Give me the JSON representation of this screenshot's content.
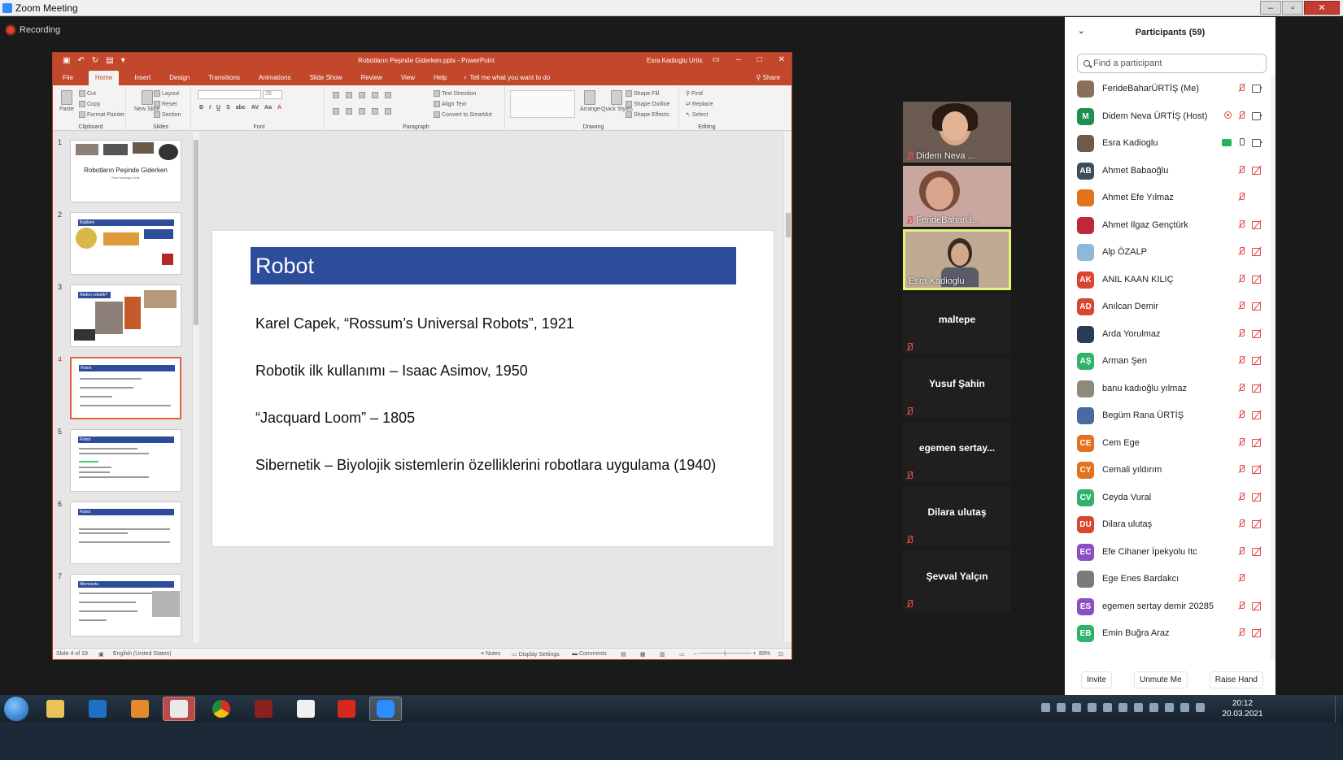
{
  "zoom": {
    "window_title": "Zoom Meeting",
    "recording_label": "Recording"
  },
  "powerpoint": {
    "doc_title": "Robotların Peşinde Giderken.pptx - PowerPoint",
    "user": "Esra Kadioglu Urtis",
    "tabs": [
      "File",
      "Home",
      "Insert",
      "Design",
      "Transitions",
      "Animations",
      "Slide Show",
      "Review",
      "View",
      "Help"
    ],
    "active_tab": "Home",
    "tell_me": "Tell me what you want to do",
    "share": "Share",
    "ribbon": {
      "paste": "Paste",
      "cut": "Cut",
      "copy": "Copy",
      "format_painter": "Format Painter",
      "clipboard": "Clipboard",
      "new_slide": "New Slide",
      "layout": "Layout",
      "reset": "Reset",
      "section": "Section",
      "slides": "Slides",
      "font": "Font",
      "font_size": "28",
      "text_direction": "Text Direction",
      "align_text": "Align Text",
      "convert_smartart": "Convert to SmartArt",
      "paragraph": "Paragraph",
      "arrange": "Arrange",
      "quick_styles": "Quick Styles",
      "shape_fill": "Shape Fill",
      "shape_outline": "Shape Outline",
      "shape_effects": "Shape Effects",
      "drawing": "Drawing",
      "find": "Find",
      "replace": "Replace",
      "select": "Select",
      "editing": "Editing"
    },
    "thumbnails": [
      {
        "num": "1",
        "title": "Robotların Peşinde Giderken",
        "subtitle": "Esra Kadioglu Urtis"
      },
      {
        "num": "2",
        "title": "Bağlantı"
      },
      {
        "num": "3",
        "title": "Neden robotik?"
      },
      {
        "num": "4",
        "title": "Robot"
      },
      {
        "num": "5",
        "title": "Robot"
      },
      {
        "num": "6",
        "title": "Robot"
      },
      {
        "num": "7",
        "title": "Minnesota"
      }
    ],
    "slide": {
      "title": "Robot",
      "lines": [
        "Karel Capek, “Rossum’s Universal Robots”, 1921",
        "Robotik ilk kullanımı – Isaac Asimov, 1950",
        "“Jacquard Loom” – 1805",
        "Sibernetik – Biyolojik sistemlerin özelliklerini robotlara uygulama (1940)"
      ]
    },
    "status": {
      "slide_info": "Slide 4 of 19",
      "language": "English (United States)",
      "notes": "Notes",
      "display_settings": "Display Settings",
      "comments": "Comments",
      "zoom": "89%"
    }
  },
  "video_tiles": [
    {
      "name": "Didem Neva ...",
      "type": "video",
      "muted": true,
      "speaking": false
    },
    {
      "name": "FerideBaharÜ...",
      "type": "video",
      "muted": true,
      "speaking": false
    },
    {
      "name": "Esra Kadioglu",
      "type": "video",
      "muted": false,
      "speaking": true
    },
    {
      "name": "maltepe",
      "type": "name",
      "muted": true
    },
    {
      "name": "Yusuf Şahin",
      "type": "name",
      "muted": true
    },
    {
      "name": "egemen sertay...",
      "type": "name",
      "muted": true
    },
    {
      "name": "Dilara ulutaş",
      "type": "name",
      "muted": true
    },
    {
      "name": "Şevval Yalçın",
      "type": "name",
      "muted": true
    }
  ],
  "participants": {
    "header": "Participants (59)",
    "search_placeholder": "Find a participant",
    "list": [
      {
        "name": "FerideBaharÜRTİŞ (Me)",
        "initials": "",
        "color": "#8a6f5c",
        "mic": "off",
        "cam": "on"
      },
      {
        "name": "Didem Neva ÜRTİŞ (Host)",
        "initials": "M",
        "color": "#1e8f4e",
        "mic": "off",
        "cam": "on",
        "rec": true
      },
      {
        "name": "Esra Kadioglu",
        "initials": "",
        "color": "#6d5a4a",
        "mic": "on",
        "cam": "on",
        "share": true
      },
      {
        "name": "Ahmet Babaoğlu",
        "initials": "AB",
        "color": "#3d4d5c",
        "mic": "off",
        "cam": "off"
      },
      {
        "name": "Ahmet Efe Yılmaz",
        "initials": "",
        "color": "#e3711d",
        "mic": "off",
        "cam": "none"
      },
      {
        "name": "Ahmet Ilgaz Gençtürk",
        "initials": "",
        "color": "#c0273b",
        "mic": "off",
        "cam": "off"
      },
      {
        "name": "Alp ÖZALP",
        "initials": "",
        "color": "#8fb8d8",
        "mic": "off",
        "cam": "off"
      },
      {
        "name": "ANIL KAAN KILIÇ",
        "initials": "AK",
        "color": "#d9452f",
        "mic": "off",
        "cam": "off"
      },
      {
        "name": "Anılcan Demir",
        "initials": "AD",
        "color": "#d9452f",
        "mic": "off",
        "cam": "off"
      },
      {
        "name": "Arda Yorulmaz",
        "initials": "",
        "color": "#2b3a55",
        "mic": "off",
        "cam": "off"
      },
      {
        "name": "Arman Şen",
        "initials": "AŞ",
        "color": "#2fb36b",
        "mic": "off",
        "cam": "off"
      },
      {
        "name": "banu kadıoğlu yılmaz",
        "initials": "",
        "color": "#8e8a7a",
        "mic": "off",
        "cam": "off"
      },
      {
        "name": "Begüm Rana ÜRTİŞ",
        "initials": "",
        "color": "#4a6aa0",
        "mic": "off",
        "cam": "off"
      },
      {
        "name": "Cem Ege",
        "initials": "CE",
        "color": "#e3711d",
        "mic": "off",
        "cam": "off"
      },
      {
        "name": "Cemali yıldırım",
        "initials": "CY",
        "color": "#e3711d",
        "mic": "off",
        "cam": "off"
      },
      {
        "name": "Ceyda Vural",
        "initials": "CV",
        "color": "#2fb36b",
        "mic": "off",
        "cam": "off"
      },
      {
        "name": "Dilara ulutaş",
        "initials": "DU",
        "color": "#d9452f",
        "mic": "off",
        "cam": "off"
      },
      {
        "name": "Efe Cihaner İpekyolu Itc",
        "initials": "EC",
        "color": "#8a4fc2",
        "mic": "off",
        "cam": "off"
      },
      {
        "name": "Ege Enes Bardakcı",
        "initials": "",
        "color": "#7a7a7a",
        "mic": "off",
        "cam": "none"
      },
      {
        "name": "egemen sertay demir 20285",
        "initials": "ES",
        "color": "#8a4fc2",
        "mic": "off",
        "cam": "off"
      },
      {
        "name": "Emin Buğra Araz",
        "initials": "EB",
        "color": "#2fb36b",
        "mic": "off",
        "cam": "off"
      }
    ],
    "footer": {
      "invite": "Invite",
      "unmute_me": "Unmute Me",
      "raise_hand": "Raise Hand"
    }
  },
  "taskbar": {
    "time": "20:12",
    "date": "20.03.2021"
  }
}
